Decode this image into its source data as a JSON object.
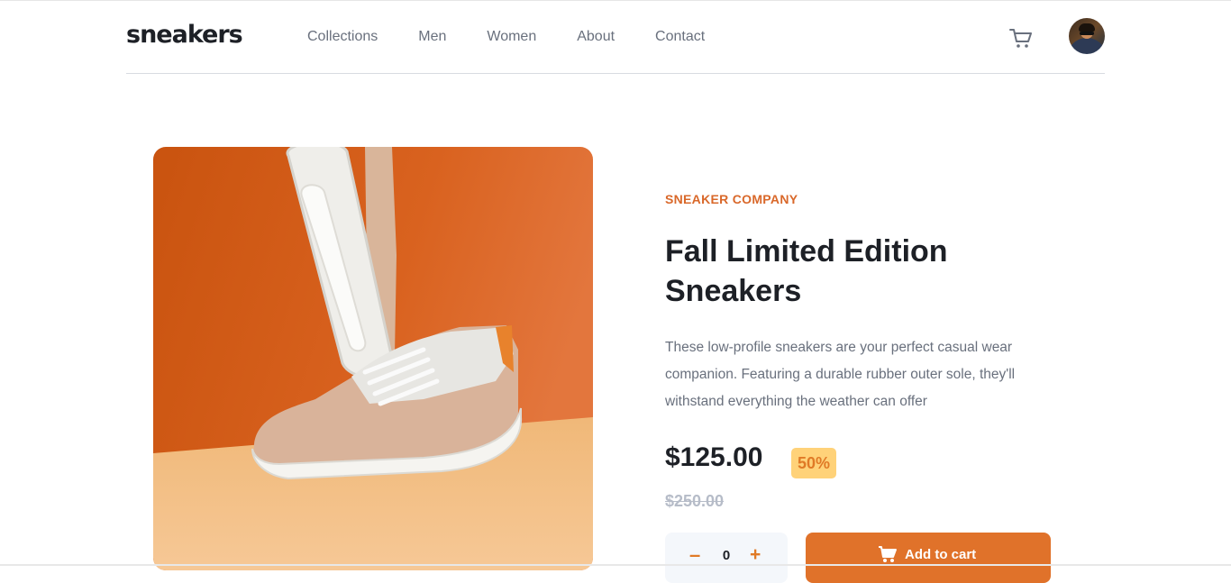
{
  "header": {
    "logo": "sneakers",
    "nav": [
      "Collections",
      "Men",
      "Women",
      "About",
      "Contact"
    ],
    "cart_icon": "cart-icon",
    "avatar_icon": "avatar"
  },
  "product": {
    "company": "SNEAKER COMPANY",
    "title": "Fall Limited Edition Sneakers",
    "description": "These low-profile sneakers are your perfect casual wear companion. Featuring a durable rubber outer sole, they'll withstand everything the weather can offer",
    "price": "$125.00",
    "discount": "50%",
    "original_price": "$250.00",
    "quantity": "0",
    "minus_label": "–",
    "plus_label": "+",
    "add_to_cart_label": "Add to cart"
  },
  "colors": {
    "accent": "#e0722a",
    "brand_orange_text": "#d9682a",
    "discount_bg": "#ffd279",
    "dark_text": "#1d2026",
    "muted_text": "#69707d"
  }
}
